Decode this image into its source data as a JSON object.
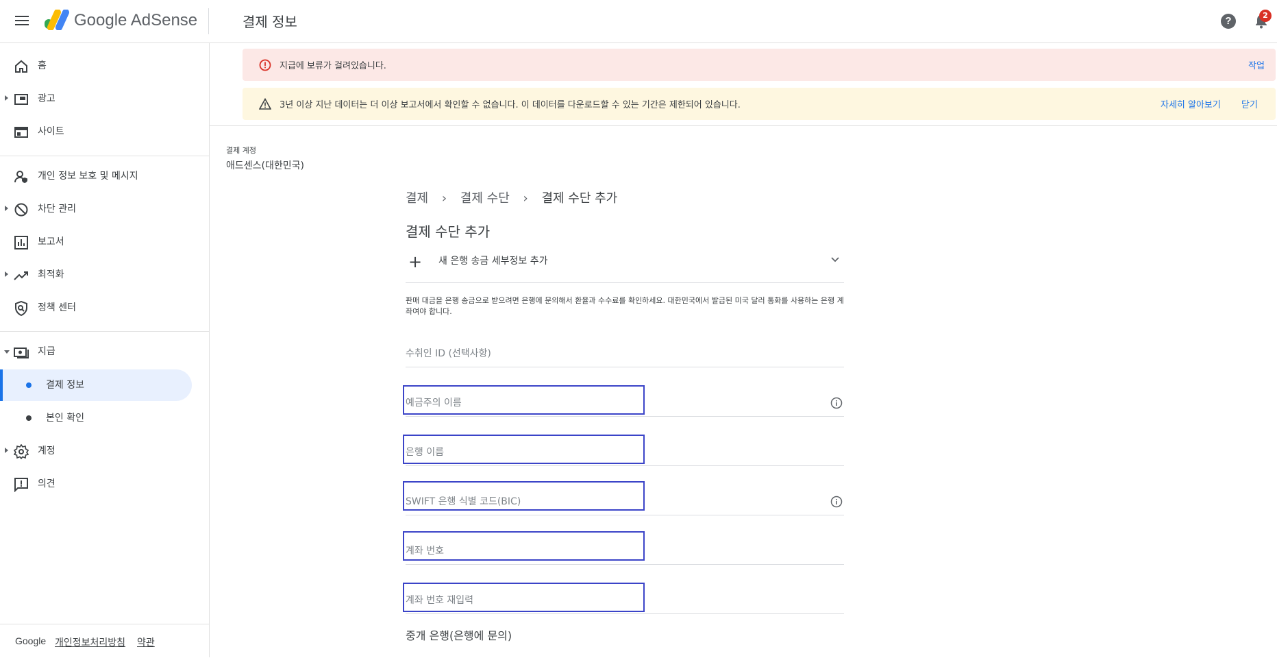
{
  "app": {
    "brand": "Google AdSense",
    "page_title": "결제 정보",
    "notification_count": "2"
  },
  "sidebar": {
    "items": [
      {
        "label": "홈",
        "icon": "home-icon"
      },
      {
        "label": "광고",
        "icon": "ads-icon"
      },
      {
        "label": "사이트",
        "icon": "sites-icon"
      },
      {
        "label": "개인 정보 보호 및 메시지",
        "icon": "privacy-icon"
      },
      {
        "label": "차단 관리",
        "icon": "block-icon"
      },
      {
        "label": "보고서",
        "icon": "reports-icon"
      },
      {
        "label": "최적화",
        "icon": "optimize-icon"
      },
      {
        "label": "정책 센터",
        "icon": "policy-icon"
      },
      {
        "label": "지급",
        "icon": "payments-icon"
      },
      {
        "label": "계정",
        "icon": "gear-icon"
      },
      {
        "label": "의견",
        "icon": "feedback-icon"
      }
    ],
    "sub_items": [
      {
        "label": "결제 정보"
      },
      {
        "label": "본인 확인"
      }
    ],
    "footer": {
      "google": "Google",
      "privacy": "개인정보처리방침",
      "terms": "약관"
    }
  },
  "alerts": {
    "error": {
      "text": "지급에 보류가 걸려있습니다.",
      "action": "작업"
    },
    "warning": {
      "text": "3년 이상 지난 데이터는 더 이상 보고서에서 확인할 수 없습니다. 이 데이터를 다운로드할 수 있는 기간은 제한되어 있습니다.",
      "learn_more": "자세히 알아보기",
      "close": "닫기"
    }
  },
  "account": {
    "label": "결제 계정",
    "name": "애드센스(대한민국)"
  },
  "breadcrumb": [
    "결제",
    "결제 수단",
    "결제 수단 추가"
  ],
  "form": {
    "title": "결제 수단 추가",
    "expander_label": "새 은행 송금 세부정보 추가",
    "description": "판매 대금을 은행 송금으로 받으려면 은행에 문의해서 환율과 수수료를 확인하세요. 대한민국에서 발급된 미국 달러 통화를 사용하는 은행 계좌여야 합니다.",
    "fields": {
      "payee_id": {
        "placeholder": "수취인 ID (선택사항)",
        "value": ""
      },
      "account_holder": {
        "placeholder": "예금주의 이름",
        "value": ""
      },
      "bank_name": {
        "placeholder": "은행 이름",
        "value": ""
      },
      "swift": {
        "placeholder": "SWIFT 은행 식별 코드(BIC)",
        "value": ""
      },
      "account_number": {
        "placeholder": "계좌 번호",
        "value": ""
      },
      "account_number_confirm": {
        "placeholder": "계좌 번호 재입력",
        "value": ""
      }
    },
    "intermediary": "중개 은행(은행에 문의)"
  },
  "colors": {
    "accent": "#1a73e8",
    "highlight": "#3b44c8",
    "error_bg": "#fce8e6",
    "warn_bg": "#fef7e0"
  }
}
